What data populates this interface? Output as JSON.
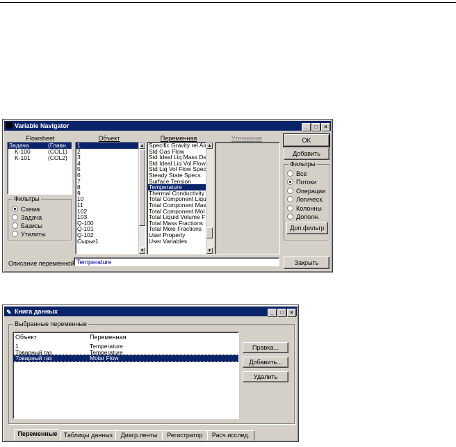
{
  "nav": {
    "title": "Variable Navigator",
    "col_flowsheet": "Flowsheet",
    "col_object": "Объект",
    "col_variable": "Переменная",
    "col_refine": "Уточнение",
    "flowsheets": [
      {
        "name": "Задача",
        "tag": "(Главн."
      },
      {
        "name": "K-100",
        "tag": "(COL1)"
      },
      {
        "name": "K-101",
        "tag": "(COL2)"
      }
    ],
    "filters_left": {
      "label": "Фильтры",
      "options": [
        "Схема",
        "Задача",
        "Базисы",
        "Утилиты"
      ]
    },
    "objects": [
      "1",
      "2",
      "3",
      "4",
      "5",
      "6",
      "7",
      "8",
      "9",
      "10",
      "11",
      "102",
      "103",
      "Q-100",
      "Q-101",
      "Q-102",
      "Сырье1"
    ],
    "variables": [
      "Specific Gravity rel Air",
      "Std Gas Flow",
      "Std Ideal Liq Mass De",
      "Std Ideal Liq Vol Flow",
      "Std Liq Vol Flow Spec",
      "Steady State Specs",
      "Surface Tension",
      "Temperature",
      "Thermal Conductivity",
      "Total Component Liqu",
      "Total Component Mas",
      "Total Component Mol",
      "Total Liquid Volume F",
      "Total Mass Fractions",
      "Total Mole Fractions",
      "User Property",
      "User Variables"
    ],
    "ok_label": "OK",
    "add_label": "Добавить",
    "filters_right": {
      "label": "Фильтры",
      "options": [
        "Все",
        "Потоки",
        "Операции",
        "Логическ.",
        "Колонны",
        "Дополн."
      ]
    },
    "extra_filter_label": "Доп.фильтр",
    "desc_label": "Описание переменной",
    "desc_value": "Temperature",
    "close_label": "Закрыть"
  },
  "book": {
    "title": "Книга данных",
    "group_label": "Выбранные переменные",
    "col_object": "Объект",
    "col_variable": "Переменная",
    "rows": [
      {
        "object": "1",
        "variable": "Temperature"
      },
      {
        "object": "Товарный газ",
        "variable": "Temperature"
      },
      {
        "object": "Товарный газ",
        "variable": "Molar Flow"
      }
    ],
    "edit_label": "Правка...",
    "add_label": "Добавить...",
    "delete_label": "Удалить",
    "tabs": [
      "Переменные",
      "Таблицы данных",
      "Диагр.ленты",
      "Регистратор",
      "Расч.исслед."
    ]
  },
  "colors": {
    "titlebar": "#0a246a",
    "dialog": "#d4d0c8",
    "selection": "#0a246a"
  }
}
